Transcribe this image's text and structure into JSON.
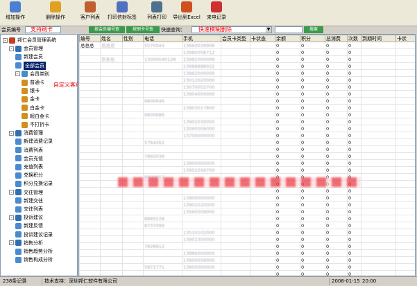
{
  "toolbar": {
    "buttons": [
      {
        "label": "增加操作",
        "icon": "add-user-icon",
        "color": "#4a7fd4"
      },
      {
        "label": "删除操作",
        "icon": "delete-hand-icon",
        "color": "#e0a020"
      },
      {
        "label": "客户列表",
        "icon": "customers-icon",
        "color": "#c06030"
      },
      {
        "label": "打印信封标签",
        "icon": "envelope-print-icon",
        "color": "#5070c0"
      },
      {
        "label": "列表打印",
        "icon": "list-print-icon",
        "color": "#507090"
      },
      {
        "label": "导出到Excel",
        "icon": "chart-export-icon",
        "color": "#d05020"
      },
      {
        "label": "来电记录",
        "icon": "call-record-icon",
        "color": "#d03030"
      }
    ]
  },
  "searchbar": {
    "member_no_label": "会员编号",
    "card_annotation": "支持刷卡",
    "btn_a": "按会员编号查",
    "btn_b": "按刷卡号查",
    "quick_query_label": "快速查询：",
    "quick_annotation": "快速模糊删除",
    "search_button": "搜索"
  },
  "tree": {
    "nodes": [
      {
        "label": "邦仁会员管理系统",
        "icon": "system-icon",
        "level": 0,
        "exp": "-"
      },
      {
        "label": "会员管理",
        "icon": "members-icon",
        "level": 1,
        "exp": "-"
      },
      {
        "label": "新建会员",
        "icon": "new-member-icon",
        "level": 2
      },
      {
        "label": "全部会员",
        "icon": "all-members-icon",
        "level": 2,
        "selected": true
      },
      {
        "label": "会员类别",
        "icon": "member-category-icon",
        "level": 2,
        "exp": "-"
      },
      {
        "label": "普通卡",
        "icon": "card-icon",
        "level": 3
      },
      {
        "label": "银卡",
        "icon": "card-icon",
        "level": 3
      },
      {
        "label": "金卡",
        "icon": "card-icon",
        "level": 3
      },
      {
        "label": "白金卡",
        "icon": "card-icon",
        "level": 3
      },
      {
        "label": "超白金卡",
        "icon": "card-icon",
        "level": 3
      },
      {
        "label": "不打折卡",
        "icon": "card-icon",
        "level": 3
      },
      {
        "label": "消费管理",
        "icon": "consumption-icon",
        "level": 1,
        "exp": "-"
      },
      {
        "label": "新建消费记录",
        "icon": "new-record-icon",
        "level": 2
      },
      {
        "label": "消费列表",
        "icon": "list-icon",
        "level": 2
      },
      {
        "label": "会员充值",
        "icon": "recharge-icon",
        "level": 2
      },
      {
        "label": "充值列表",
        "icon": "list-icon",
        "level": 2
      },
      {
        "label": "兑换积分",
        "icon": "points-icon",
        "level": 2
      },
      {
        "label": "积分兑换记录",
        "icon": "points-record-icon",
        "level": 2
      },
      {
        "label": "交往管理",
        "icon": "contact-icon",
        "level": 1,
        "exp": "-"
      },
      {
        "label": "新建交往",
        "icon": "new-contact-icon",
        "level": 2
      },
      {
        "label": "交往列表",
        "icon": "list-icon",
        "level": 2
      },
      {
        "label": "投诉建议",
        "icon": "complaint-icon",
        "level": 1,
        "exp": "-"
      },
      {
        "label": "新建反馈",
        "icon": "new-feedback-icon",
        "level": 2
      },
      {
        "label": "投诉建议记录",
        "icon": "feedback-record-icon",
        "level": 2
      },
      {
        "label": "销售分析",
        "icon": "sales-icon",
        "level": 1,
        "exp": "-"
      },
      {
        "label": "销售趋势分析",
        "icon": "trend-icon",
        "level": 2
      },
      {
        "label": "销售构成分析",
        "icon": "composition-icon",
        "level": 2
      }
    ],
    "annotation": "自定义客户分组"
  },
  "grid": {
    "columns": [
      "编号",
      "姓名",
      "性别",
      "电话",
      "手机",
      "会员卡类型",
      "卡状态",
      "余额",
      "积分",
      "总消费",
      "次数",
      "到期时间",
      "卡状"
    ],
    "rows": [
      [
        "总总总",
        "总总总",
        "",
        "5570044",
        "13660039906",
        "",
        "",
        "0",
        "0",
        "0",
        "0",
        "",
        ""
      ],
      [
        "",
        "",
        "",
        "",
        "13980008712",
        "",
        "",
        "0",
        "0",
        "0",
        "0",
        "",
        ""
      ],
      [
        "",
        "京东化",
        "",
        "13000040128",
        "13982000099",
        "",
        "",
        "0",
        "0",
        "0",
        "0",
        "",
        ""
      ],
      [
        "",
        "",
        "",
        "",
        "13988888022",
        "",
        "",
        "0",
        "0",
        "0",
        "0",
        "",
        ""
      ],
      [
        "",
        "",
        "",
        "",
        "13962000000",
        "",
        "",
        "0",
        "0",
        "0",
        "0",
        "",
        ""
      ],
      [
        "",
        "",
        "",
        "",
        "13012020000",
        "",
        "",
        "0",
        "0",
        "0",
        "0",
        "",
        ""
      ],
      [
        "",
        "",
        "",
        "",
        "13070052700",
        "",
        "",
        "0",
        "0",
        "0",
        "0",
        "",
        ""
      ],
      [
        "",
        "",
        "",
        "",
        "13904000000",
        "",
        "",
        "0",
        "0",
        "0",
        "0",
        "",
        ""
      ],
      [
        "",
        "",
        "",
        "6800646",
        "",
        "",
        "",
        "0",
        "0",
        "0",
        "0",
        "",
        ""
      ],
      [
        "",
        "",
        "",
        "",
        "13903017800",
        "",
        "",
        "0",
        "0",
        "0",
        "0",
        "",
        ""
      ],
      [
        "",
        "",
        "",
        "6800686",
        "",
        "",
        "",
        "0",
        "0",
        "0",
        "0",
        "",
        ""
      ],
      [
        "",
        "",
        "",
        "",
        "13902030000",
        "",
        "",
        "0",
        "0",
        "0",
        "0",
        "",
        ""
      ],
      [
        "",
        "",
        "",
        "",
        "13060006000",
        "",
        "",
        "0",
        "0",
        "0",
        "0",
        "",
        ""
      ],
      [
        "",
        "",
        "",
        "",
        "13700000000",
        "",
        "",
        "0",
        "0",
        "0",
        "0",
        "",
        ""
      ],
      [
        "",
        "",
        "",
        "5764262",
        "",
        "",
        "",
        "0",
        "0",
        "0",
        "0",
        "",
        ""
      ],
      [
        "",
        "",
        "",
        "",
        "",
        "",
        "",
        "0",
        "0",
        "0",
        "0",
        "",
        ""
      ],
      [
        "",
        "",
        "",
        "7860036",
        "",
        "",
        "",
        "0",
        "0",
        "0",
        "0",
        "",
        ""
      ],
      [
        "",
        "",
        "",
        "",
        "13900000000",
        "",
        "",
        "0",
        "0",
        "0",
        "0",
        "",
        ""
      ],
      [
        "",
        "",
        "",
        "",
        "13952206700",
        "",
        "",
        "0",
        "0",
        "0",
        "0",
        "",
        ""
      ],
      [
        "",
        "",
        "",
        "8900057",
        "",
        "",
        "",
        "0",
        "0",
        "0",
        "0",
        "",
        ""
      ],
      [
        "",
        "",
        "",
        "",
        "",
        "",
        "",
        "0",
        "0",
        "0",
        "0",
        "",
        ""
      ],
      [
        "",
        "",
        "",
        "",
        "",
        "",
        "",
        "0",
        "0",
        "0",
        "0",
        "",
        ""
      ],
      [
        "",
        "",
        "",
        "",
        "13900000000",
        "",
        "",
        "0",
        "0",
        "0",
        "0",
        "",
        ""
      ],
      [
        "",
        "",
        "",
        "",
        "13902020000",
        "",
        "",
        "0",
        "0",
        "0",
        "0",
        "",
        ""
      ],
      [
        "",
        "",
        "",
        "",
        "13560009000",
        "",
        "",
        "0",
        "0",
        "0",
        "0",
        "",
        ""
      ],
      [
        "",
        "",
        "",
        "8885538",
        "",
        "",
        "",
        "0",
        "0",
        "0",
        "0",
        "",
        ""
      ],
      [
        "",
        "",
        "",
        "8737099",
        "",
        "",
        "",
        "0",
        "0",
        "0",
        "0",
        "",
        ""
      ],
      [
        "",
        "",
        "",
        "",
        "13510102000",
        "",
        "",
        "0",
        "0",
        "0",
        "0",
        "",
        ""
      ],
      [
        "",
        "",
        "",
        "",
        "13902300000",
        "",
        "",
        "0",
        "0",
        "0",
        "0",
        "",
        ""
      ],
      [
        "",
        "",
        "",
        "7828912",
        "",
        "",
        "",
        "0",
        "0",
        "0",
        "0",
        "",
        ""
      ],
      [
        "",
        "",
        "",
        "",
        "13986000000",
        "",
        "",
        "0",
        "0",
        "0",
        "0",
        "",
        ""
      ],
      [
        "",
        "",
        "",
        "",
        "13900056000",
        "",
        "",
        "0",
        "0",
        "0",
        "0",
        "",
        ""
      ],
      [
        "",
        "",
        "",
        "5871771",
        "13950000000",
        "",
        "",
        "0",
        "0",
        "0",
        "0",
        "",
        ""
      ],
      [
        "",
        "",
        "",
        "",
        "",
        "",
        "",
        "0",
        "0",
        "0",
        "0",
        "",
        ""
      ]
    ]
  },
  "overlay": {
    "band_color": "#eb3c46"
  },
  "status": {
    "records": "238条记录",
    "support": "技术支持：深圳邦仁软件有限公司",
    "datetime": "2008-01-15",
    "time": "20:00"
  }
}
